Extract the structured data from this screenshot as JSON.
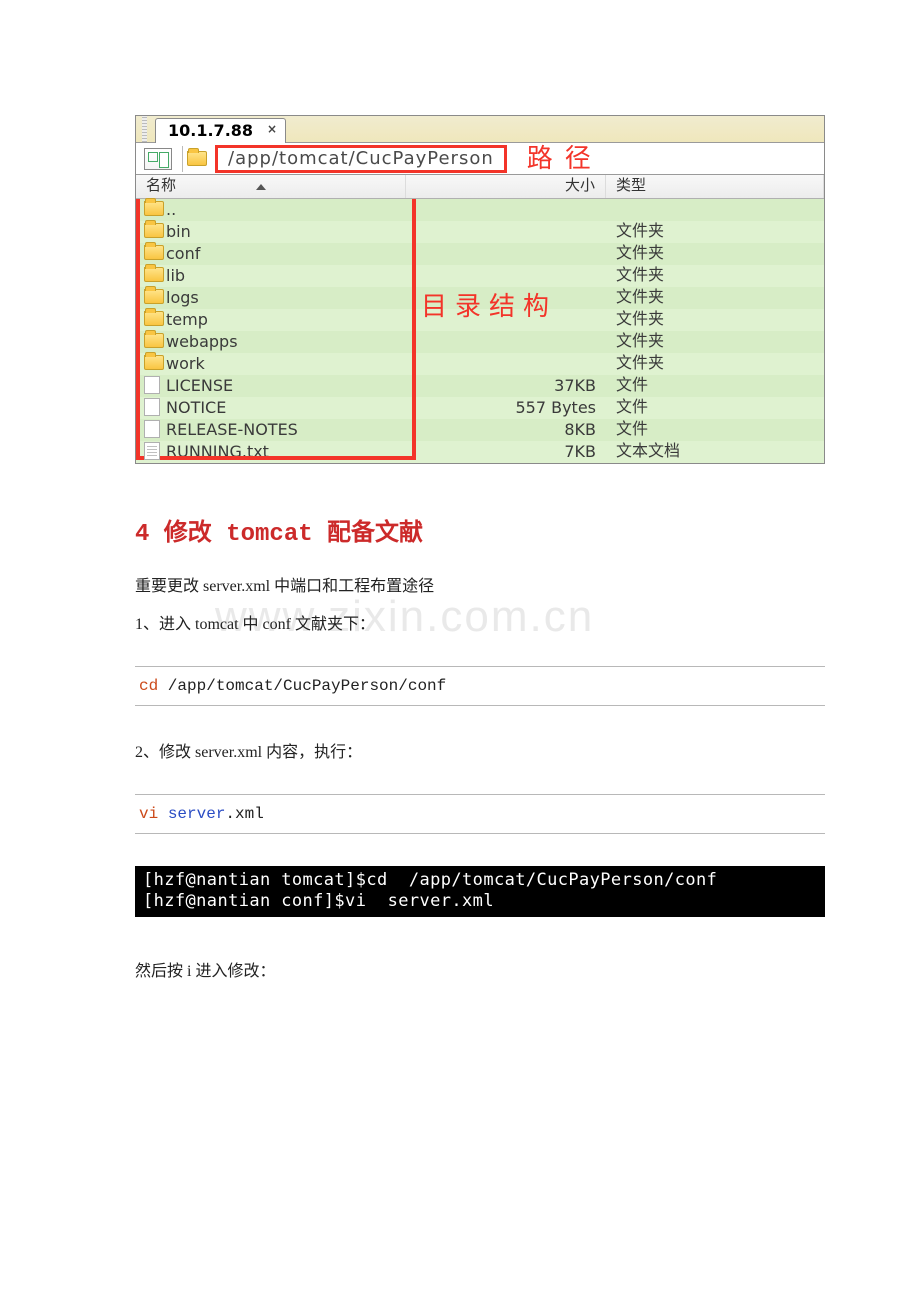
{
  "tab": {
    "title": "10.1.7.88",
    "close": "×"
  },
  "address": {
    "path": "/app/tomcat/CucPayPerson",
    "annotation": "路径"
  },
  "columns": {
    "name": "名称",
    "size": "大小",
    "type": "类型"
  },
  "dir_annotation": "目录结构",
  "rows": [
    {
      "name": "..",
      "size": "",
      "type": "",
      "icon": "folder"
    },
    {
      "name": "bin",
      "size": "",
      "type": "文件夹",
      "icon": "folder"
    },
    {
      "name": "conf",
      "size": "",
      "type": "文件夹",
      "icon": "folder"
    },
    {
      "name": "lib",
      "size": "",
      "type": "文件夹",
      "icon": "folder"
    },
    {
      "name": "logs",
      "size": "",
      "type": "文件夹",
      "icon": "folder"
    },
    {
      "name": "temp",
      "size": "",
      "type": "文件夹",
      "icon": "folder"
    },
    {
      "name": "webapps",
      "size": "",
      "type": "文件夹",
      "icon": "folder"
    },
    {
      "name": "work",
      "size": "",
      "type": "文件夹",
      "icon": "folder"
    },
    {
      "name": "LICENSE",
      "size": "37KB",
      "type": "文件",
      "icon": "file"
    },
    {
      "name": "NOTICE",
      "size": "557 Bytes",
      "type": "文件",
      "icon": "file"
    },
    {
      "name": "RELEASE-NOTES",
      "size": "8KB",
      "type": "文件",
      "icon": "file"
    },
    {
      "name": "RUNNING.txt",
      "size": "7KB",
      "type": "文本文档",
      "icon": "txt"
    }
  ],
  "section4": "4 修改 tomcat 配备文献",
  "line_a": "重要更改 server.xml 中端口和工程布置途径",
  "line_b": "1、进入 tomcat 中 conf 文献夹下：",
  "watermark": "www.zixin.com.cn",
  "code1": {
    "kw": "cd",
    "rest": " /app/tomcat/CucPayPerson/conf"
  },
  "line_c": "2、修改 server.xml 内容，执行：",
  "code2": {
    "kw": "vi",
    "sp": "  ",
    "kw2": "server",
    "rest": ".xml"
  },
  "terminal": {
    "l1": "[hzf@nantian tomcat]$cd  /app/tomcat/CucPayPerson/conf",
    "l2": "[hzf@nantian conf]$vi  server.xml"
  },
  "line_d": "然后按 i 进入修改："
}
